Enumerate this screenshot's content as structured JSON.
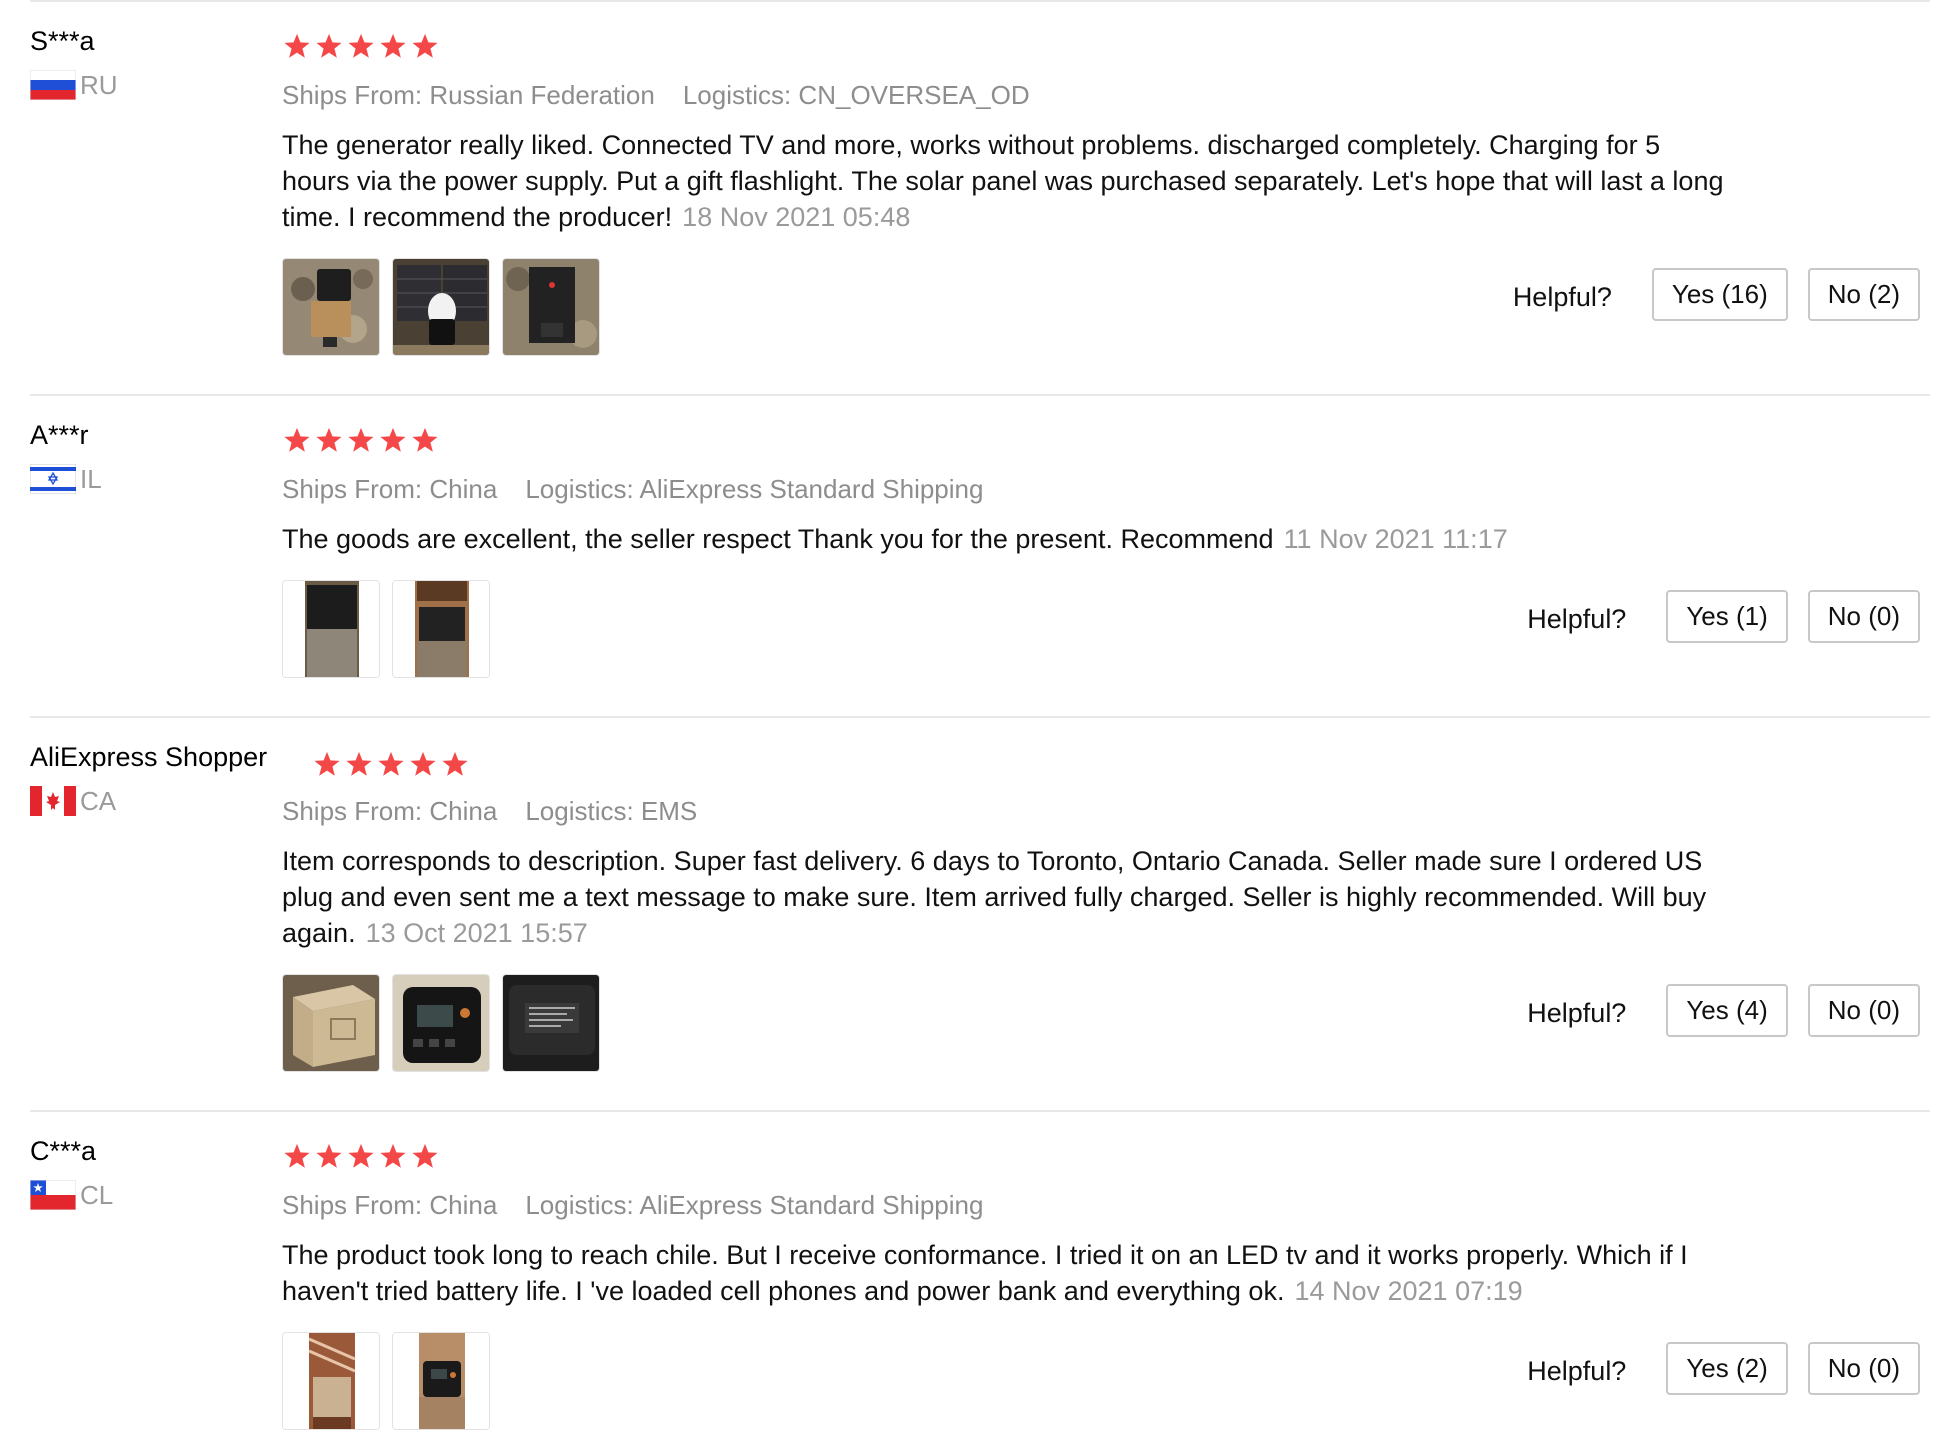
{
  "colors": {
    "star": "#f44747",
    "muted_text": "#8d8d8d",
    "divider": "#e8e8e8",
    "button_border": "#c8c8c8"
  },
  "helpful_label": "Helpful?",
  "reviews": [
    {
      "user": "S***a",
      "country_code": "RU",
      "flag_icon": "russia-flag-icon",
      "stars": 5,
      "ships_from": "Ships From: Russian Federation",
      "logistics": "Logistics: CN_OVERSEA_OD",
      "text": "The generator really liked. Connected TV and more, works without problems. discharged completely. Charging for 5 hours via the power supply. Put a gift flashlight. The solar panel was purchased separately. Let's hope that will last a long time. I recommend the producer!",
      "date": "18 Nov 2021 05:48",
      "photos": [
        "review-photo-1",
        "review-photo-2",
        "review-photo-3"
      ],
      "yes_label": "Yes (16)",
      "no_label": "No (2)"
    },
    {
      "user": "A***r",
      "country_code": "IL",
      "flag_icon": "israel-flag-icon",
      "stars": 5,
      "ships_from": "Ships From: China",
      "logistics": "Logistics: AliExpress Standard Shipping",
      "text": "The goods are excellent, the seller respect Thank you for the present. Recommend",
      "date": "11 Nov 2021 11:17",
      "photos": [
        "review-photo-1",
        "review-photo-2"
      ],
      "yes_label": "Yes (1)",
      "no_label": "No (0)"
    },
    {
      "user": "AliExpress Shopper",
      "country_code": "CA",
      "flag_icon": "canada-flag-icon",
      "stars": 5,
      "ships_from": "Ships From: China",
      "logistics": "Logistics: EMS",
      "text": "Item corresponds to description. Super fast delivery. 6 days to Toronto, Ontario Canada. Seller made sure I ordered US plug and even sent me a text message to make sure. Item arrived fully charged. Seller is highly recommended. Will buy again.",
      "date": "13 Oct 2021 15:57",
      "photos": [
        "review-photo-1",
        "review-photo-2",
        "review-photo-3"
      ],
      "yes_label": "Yes (4)",
      "no_label": "No (0)"
    },
    {
      "user": "C***a",
      "country_code": "CL",
      "flag_icon": "chile-flag-icon",
      "stars": 5,
      "ships_from": "Ships From: China",
      "logistics": "Logistics: AliExpress Standard Shipping",
      "text": "The product took long to reach chile. But I receive conformance. I tried it on an LED tv and it works properly. Which if I haven't tried battery life. I 've loaded cell phones and power bank and everything ok.",
      "date": "14 Nov 2021 07:19",
      "photos": [
        "review-photo-1",
        "review-photo-2"
      ],
      "yes_label": "Yes (2)",
      "no_label": "No (0)"
    }
  ]
}
